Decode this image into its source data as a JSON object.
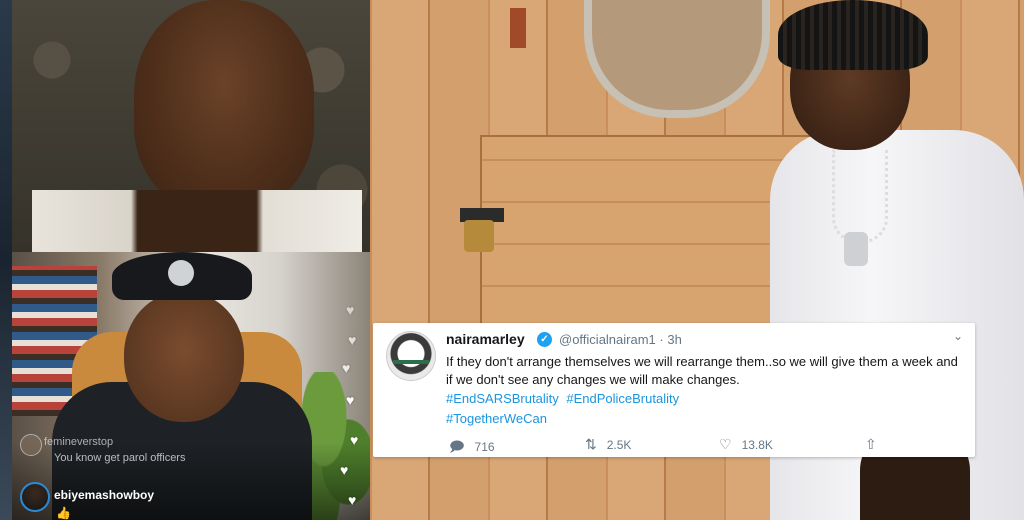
{
  "live_comments": [
    {
      "username": "femineverstop",
      "message": "You know get parol officers"
    },
    {
      "username": "ebiyemashowboy",
      "message": "👍"
    }
  ],
  "tweet": {
    "display_name": "nairamarley",
    "verified": true,
    "handle": "@officialnairam1",
    "separator": "·",
    "time": "3h",
    "text": "If they don't arrange themselves we will rearrange them..so we will give them a week and if we don't see any changes we will make changes.",
    "hashtags": [
      "#EndSARSBrutality",
      "#EndPoliceBrutality",
      "#TogetherWeCan"
    ],
    "actions": {
      "replies": "716",
      "retweets": "2.5K",
      "likes": "13.8K"
    },
    "icons": {
      "verified": "verified-badge-icon",
      "menu": "chevron-down-icon",
      "reply": "reply-icon",
      "retweet": "retweet-icon",
      "like": "heart-icon",
      "share": "share-icon"
    }
  },
  "colors": {
    "twitter_blue": "#1da1f2",
    "hashtag_blue": "#1b95e0",
    "muted_gray": "#657786"
  }
}
